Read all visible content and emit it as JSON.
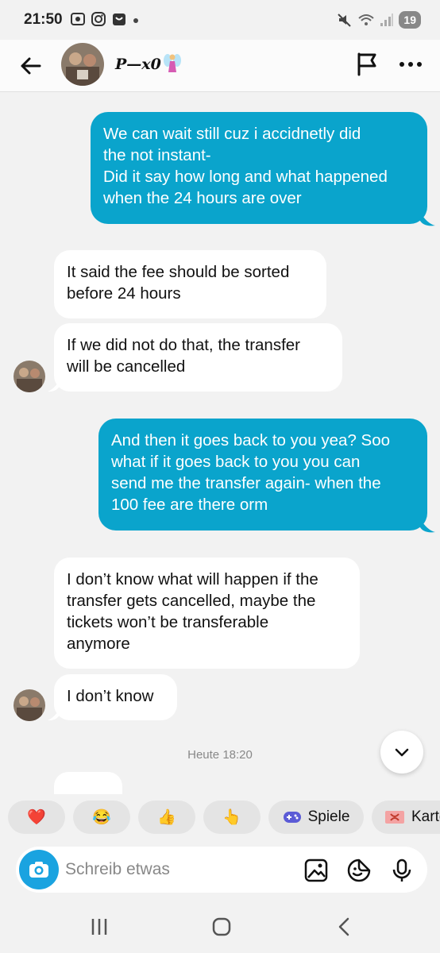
{
  "status_bar": {
    "time": "21:50",
    "battery": "19"
  },
  "header": {
    "contact_name": "P—x0"
  },
  "messages": [
    {
      "dir": "out",
      "text": "We can wait still cuz i accidnetly did\nthe not instant-\nDid it say how long and what happened\nwhen the 24 hours are over"
    },
    {
      "dir": "in",
      "text": "It said the fee should be sorted\nbefore 24 hours"
    },
    {
      "dir": "in",
      "text": "If we did not do that, the transfer\nwill be cancelled"
    },
    {
      "dir": "out",
      "text": "And then it goes back to you yea? Soo\nwhat if it goes back to you you can\nsend me the transfer again- when the\n100 fee are there orm"
    },
    {
      "dir": "in",
      "text": "I don’t know what will happen if the\ntransfer gets cancelled, maybe the\ntickets won’t be transferable\nanymore"
    },
    {
      "dir": "in",
      "text": "I don’t know"
    }
  ],
  "timestamp": "Heute 18:20",
  "quick_actions": [
    {
      "icon": "heart-emoji",
      "glyph": "❤️"
    },
    {
      "icon": "laughing-emoji",
      "glyph": "😂"
    },
    {
      "icon": "thumbs-up-emoji",
      "glyph": "👍"
    },
    {
      "icon": "pointing-emoji",
      "glyph": "👆"
    },
    {
      "icon": "gamepad-icon",
      "label": "Spiele"
    },
    {
      "icon": "gift-card-icon",
      "label": "Karte"
    }
  ],
  "compose": {
    "placeholder": "Schreib etwas"
  },
  "colors": {
    "outgoing": "#0aa4cc",
    "incoming": "#ffffff",
    "background": "#f2f2f2",
    "camera": "#1aa3e0"
  }
}
